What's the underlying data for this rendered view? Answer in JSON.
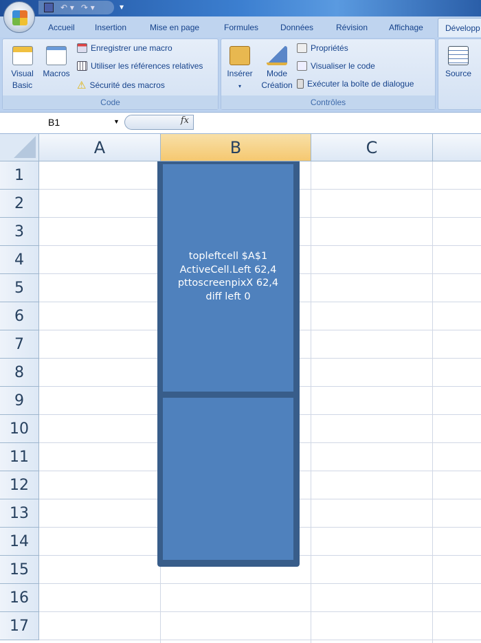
{
  "quick_access": {
    "save_icon": "save-icon",
    "undo_icon": "undo-icon",
    "redo_icon": "redo-icon",
    "customize": "▾"
  },
  "tabs": [
    "Accueil",
    "Insertion",
    "Mise en page",
    "Formules",
    "Données",
    "Révision",
    "Affichage",
    "Développ"
  ],
  "active_tab": "Développ",
  "ribbon": {
    "code": {
      "label": "Code",
      "visual_basic": [
        "Visual",
        "Basic"
      ],
      "macros": "Macros",
      "record": "Enregistrer une macro",
      "relative": "Utiliser les références relatives",
      "security": "Sécurité des macros"
    },
    "controls": {
      "label": "Contrôles",
      "insert": "Insérer",
      "insert_arrow": "▾",
      "design": [
        "Mode",
        "Création"
      ],
      "properties": "Propriétés",
      "view_code": "Visualiser le code",
      "run_dialog": "Exécuter la boîte de dialogue"
    },
    "xml": {
      "source": "Source"
    }
  },
  "formula_bar": {
    "name_box": "B1",
    "dropdown": "▼",
    "fx": "fx",
    "formula": ""
  },
  "columns": [
    "A",
    "B",
    "C"
  ],
  "rows": [
    "1",
    "2",
    "3",
    "4",
    "5",
    "6",
    "7",
    "8",
    "9",
    "10",
    "11",
    "12",
    "13",
    "14",
    "15",
    "16",
    "17"
  ],
  "shape": {
    "lines": [
      "topleftcell $A$1",
      "ActiveCell.Left 62,4",
      "pttoscreenpixX 62,4",
      "diff left 0"
    ],
    "fill": "#4f81bd",
    "border": "#385d8a"
  }
}
